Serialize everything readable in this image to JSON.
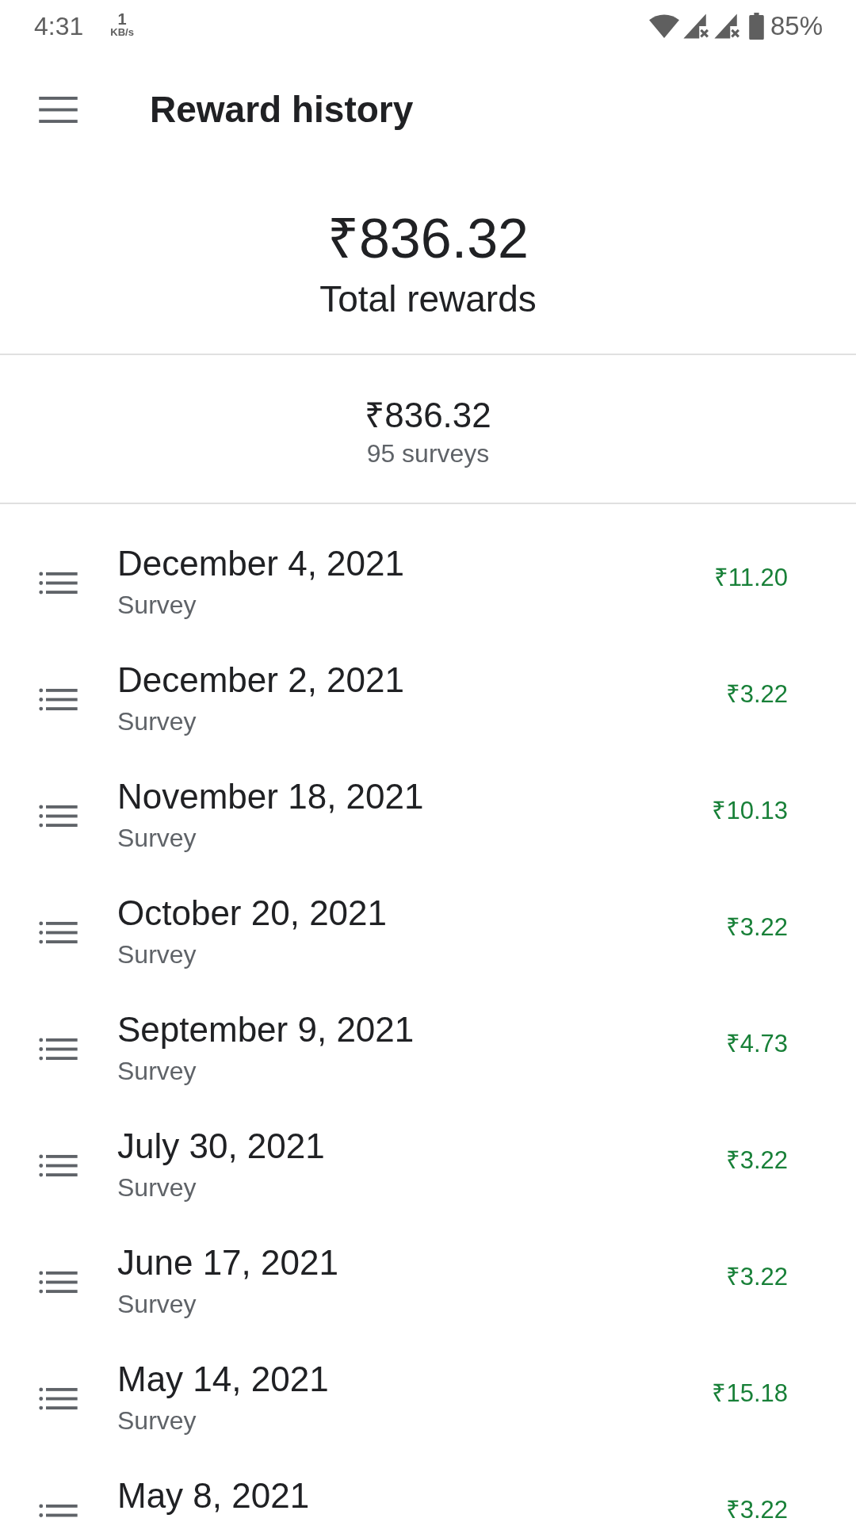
{
  "status_bar": {
    "time": "4:31",
    "net_speed": "1",
    "net_unit": "KB/s",
    "battery_text": "85%"
  },
  "app_bar": {
    "title": "Reward history"
  },
  "summary": {
    "total": "₹836.32",
    "label": "Total rewards"
  },
  "subtotal": {
    "amount": "₹836.32",
    "count": "95 surveys"
  },
  "rewards": [
    {
      "date": "December 4, 2021",
      "type": "Survey",
      "amount": "₹11.20"
    },
    {
      "date": "December 2, 2021",
      "type": "Survey",
      "amount": "₹3.22"
    },
    {
      "date": "November 18, 2021",
      "type": "Survey",
      "amount": "₹10.13"
    },
    {
      "date": "October 20, 2021",
      "type": "Survey",
      "amount": "₹3.22"
    },
    {
      "date": "September 9, 2021",
      "type": "Survey",
      "amount": "₹4.73"
    },
    {
      "date": "July 30, 2021",
      "type": "Survey",
      "amount": "₹3.22"
    },
    {
      "date": "June 17, 2021",
      "type": "Survey",
      "amount": "₹3.22"
    },
    {
      "date": "May 14, 2021",
      "type": "Survey",
      "amount": "₹15.18"
    },
    {
      "date": "May 8, 2021",
      "amount": "₹3.22"
    }
  ]
}
